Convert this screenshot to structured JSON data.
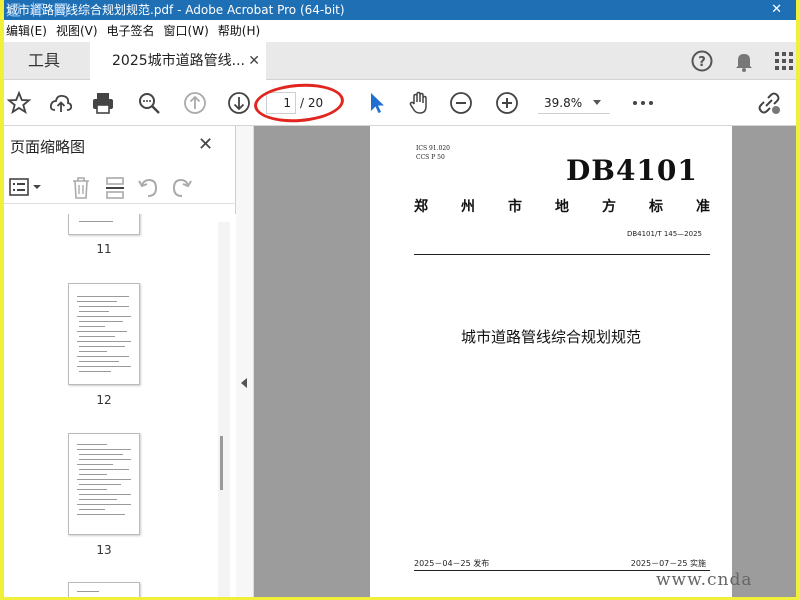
{
  "window": {
    "title": "城市道路管线综合规划规范.pdf - Adobe Acrobat Pro (64-bit)",
    "watermark": "迈 杯 网"
  },
  "menu": [
    "编辑(E)",
    "视图(V)",
    "电子签名",
    "窗口(W)",
    "帮助(H)"
  ],
  "tabs": {
    "tools": "工具",
    "document": "2025城市道路管线..."
  },
  "toolbar": {
    "page_current": "1",
    "page_total": "/ 20",
    "zoom": "39.8%"
  },
  "left_panel": {
    "title": "页面缩略图",
    "thumbnails": [
      {
        "label": "11"
      },
      {
        "label": "12"
      },
      {
        "label": "13"
      }
    ]
  },
  "document": {
    "ics": "ICS  91.020",
    "ccs": "CCS  P 50",
    "db_code": "DB4101",
    "std_title": [
      "郑",
      "州",
      "市",
      "地",
      "方",
      "标",
      "准"
    ],
    "std_number": "DB4101/T 145—2025",
    "name": "城市道路管线综合规划规范",
    "publish_date": "2025－04－25 发布",
    "implement_date": "2025－07－25 实施"
  },
  "footer_watermark": "www.cnda",
  "colors": {
    "titlebar": "#1f6fb5",
    "annotation_red": "#e0261f",
    "cursor_blue": "#1f6fd1",
    "frame_yellow": "#f0ef3a"
  }
}
